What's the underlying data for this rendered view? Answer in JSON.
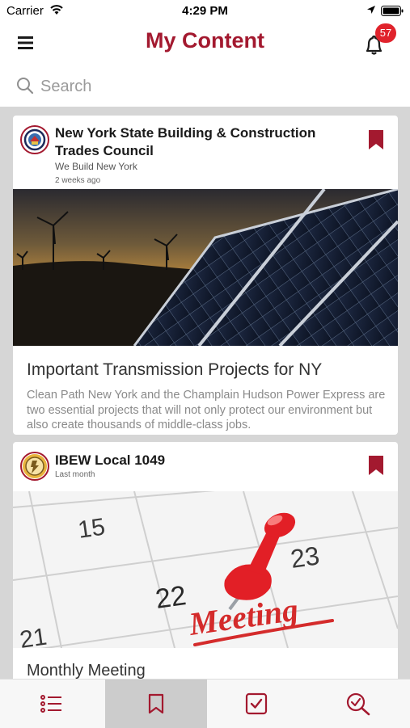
{
  "status_bar": {
    "carrier": "Carrier",
    "time": "4:29 PM"
  },
  "header": {
    "title": "My Content",
    "notification_count": "57"
  },
  "search": {
    "placeholder": "Search",
    "value": ""
  },
  "posts": [
    {
      "org": "New York State Building & Construction Trades Council",
      "tagline": "We Build New York",
      "time_ago": "2 weeks ago",
      "title": "Important Transmission Projects for NY",
      "description": "Clean Path New York and the Champlain Hudson Power Express are two essential projects that will not only protect our environment but also create thousands of middle-class jobs.",
      "image": "solar-panels-wind-turbines-sunset",
      "bookmarked": true
    },
    {
      "org": "IBEW Local 1049",
      "time_ago": "Last month",
      "title": "Monthly Meeting",
      "image": "calendar-meeting-pushpin",
      "image_text": {
        "date_a": "15",
        "date_b": "22",
        "date_c": "23",
        "date_d": "21",
        "word": "Meeting"
      },
      "bookmarked": true
    }
  ],
  "tabs": [
    {
      "name": "list-icon",
      "active": false
    },
    {
      "name": "bookmark-icon",
      "active": true
    },
    {
      "name": "checkbox-icon",
      "active": false
    },
    {
      "name": "search-check-icon",
      "active": false
    }
  ],
  "colors": {
    "brand": "#a3192f",
    "badge": "#e0232c"
  }
}
